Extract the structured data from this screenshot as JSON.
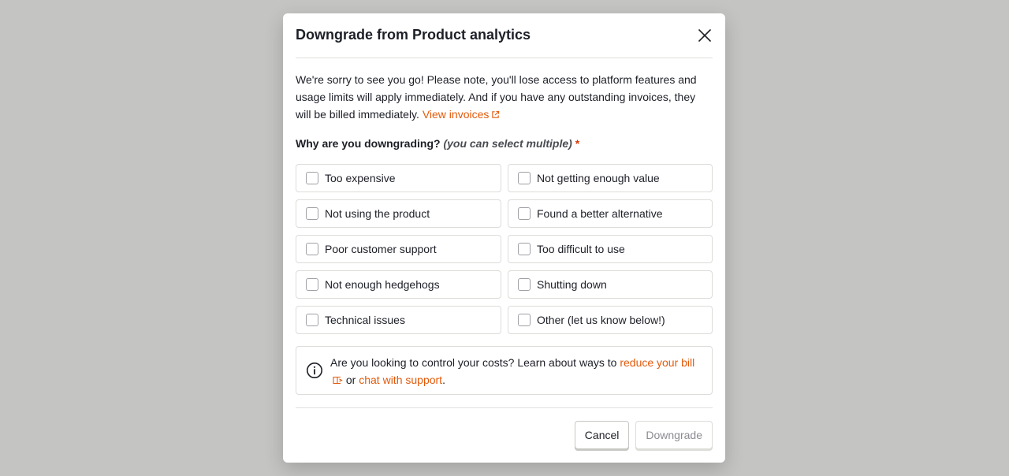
{
  "modal": {
    "title": "Downgrade from Product analytics",
    "body_text": "We're sorry to see you go! Please note, you'll lose access to platform features and usage limits will apply immediately. And if you have any outstanding invoices, they will be billed immediately.",
    "view_invoices_link": "View invoices",
    "question": "Why are you downgrading?",
    "question_hint": "(you can select multiple)",
    "required_marker": "*",
    "options": [
      "Too expensive",
      "Not getting enough value",
      "Not using the product",
      "Found a better alternative",
      "Poor customer support",
      "Too difficult to use",
      "Not enough hedgehogs",
      "Shutting down",
      "Technical issues",
      "Other (let us know below!)"
    ],
    "info": {
      "text_before": "Are you looking to control your costs? Learn about ways to",
      "reduce_bill_link": "reduce your bill",
      "text_or": "or",
      "chat_support_link": "chat with support",
      "text_end": "."
    },
    "cancel_label": "Cancel",
    "downgrade_label": "Downgrade"
  },
  "colors": {
    "backdrop": "#c4c4c2",
    "link": "#e35a0b",
    "required": "#db3707"
  }
}
